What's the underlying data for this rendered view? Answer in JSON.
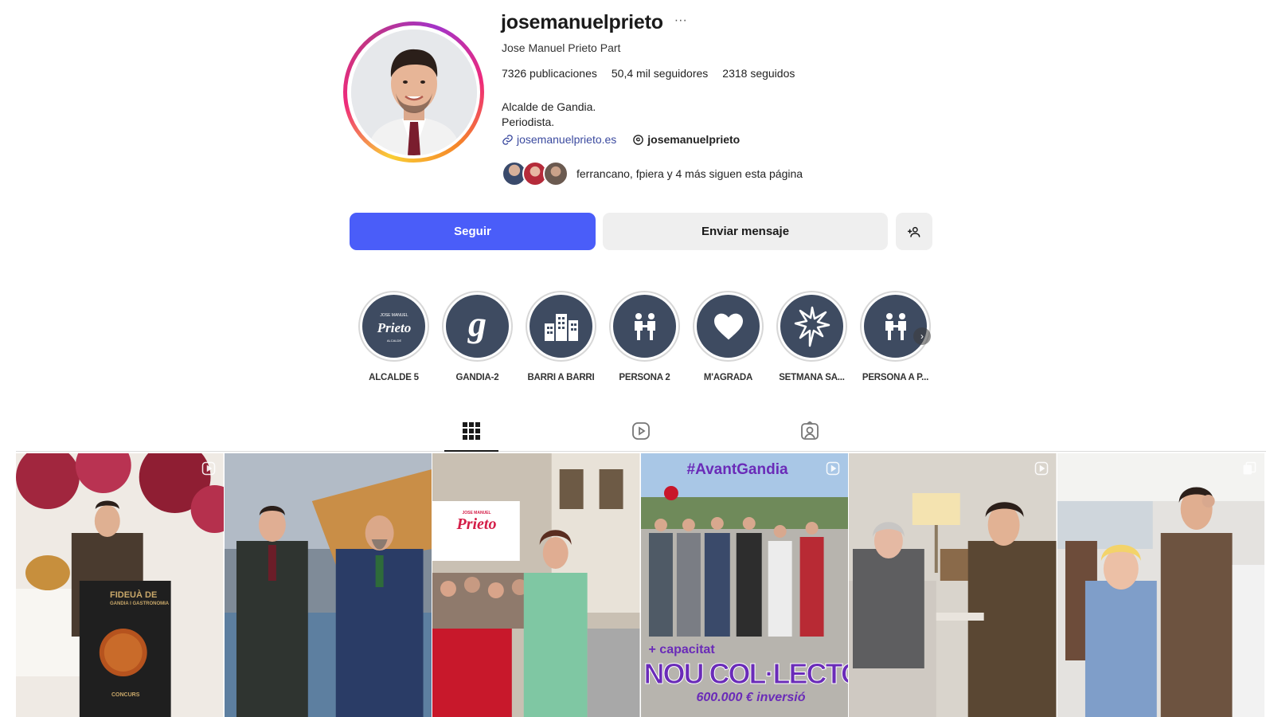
{
  "profile": {
    "username": "josemanuelprieto",
    "full_name": "Jose Manuel Prieto Part",
    "stats": {
      "posts": "7326 publicaciones",
      "followers": "50,4 mil seguidores",
      "following": "2318 seguidos"
    },
    "bio_line1": "Alcalde de Gandia.",
    "bio_line2": "Periodista.",
    "website": "josemanuelprieto.es",
    "threads": "josemanuelprieto",
    "followed_by": "ferrancano, fpiera y 4 más siguen esta página"
  },
  "actions": {
    "follow_label": "Seguir",
    "message_label": "Enviar mensaje"
  },
  "highlights": [
    {
      "label": "ALCALDE 5",
      "icon": "prieto-logo-icon"
    },
    {
      "label": "GANDIA-2",
      "icon": "letter-g-icon"
    },
    {
      "label": "BARRI A BARRI",
      "icon": "buildings-icon"
    },
    {
      "label": "PERSONA 2",
      "icon": "people-icon"
    },
    {
      "label": "M'AGRADA",
      "icon": "heart-icon"
    },
    {
      "label": "SETMANA SA...",
      "icon": "star-burst-icon"
    },
    {
      "label": "PERSONA A P...",
      "icon": "people-icon"
    }
  ],
  "tabs": {
    "posts_icon": "grid-icon",
    "reels_icon": "reels-icon",
    "tagged_icon": "tagged-icon"
  },
  "posts": [
    {
      "caption_1": "FIDEUÀ DE",
      "caption_2": "GANDIA I GASTRONOMIA",
      "caption_3": "CONCURS",
      "type": "reel"
    },
    {
      "type": "photo"
    },
    {
      "sign_1": "JOSE MANUEL",
      "sign_2": "Prieto",
      "type": "photo"
    },
    {
      "hashtag": "#AvantGandia",
      "line1": "+ capacitat",
      "line2": "NOU COL·LECTOR",
      "line3": "600.000 € inversió",
      "type": "reel"
    },
    {
      "type": "reel"
    },
    {
      "type": "carousel"
    }
  ],
  "colors": {
    "accent": "#4a5df9",
    "highlight_bg": "#3e4b61",
    "post4_text": "#6a2bb8"
  }
}
